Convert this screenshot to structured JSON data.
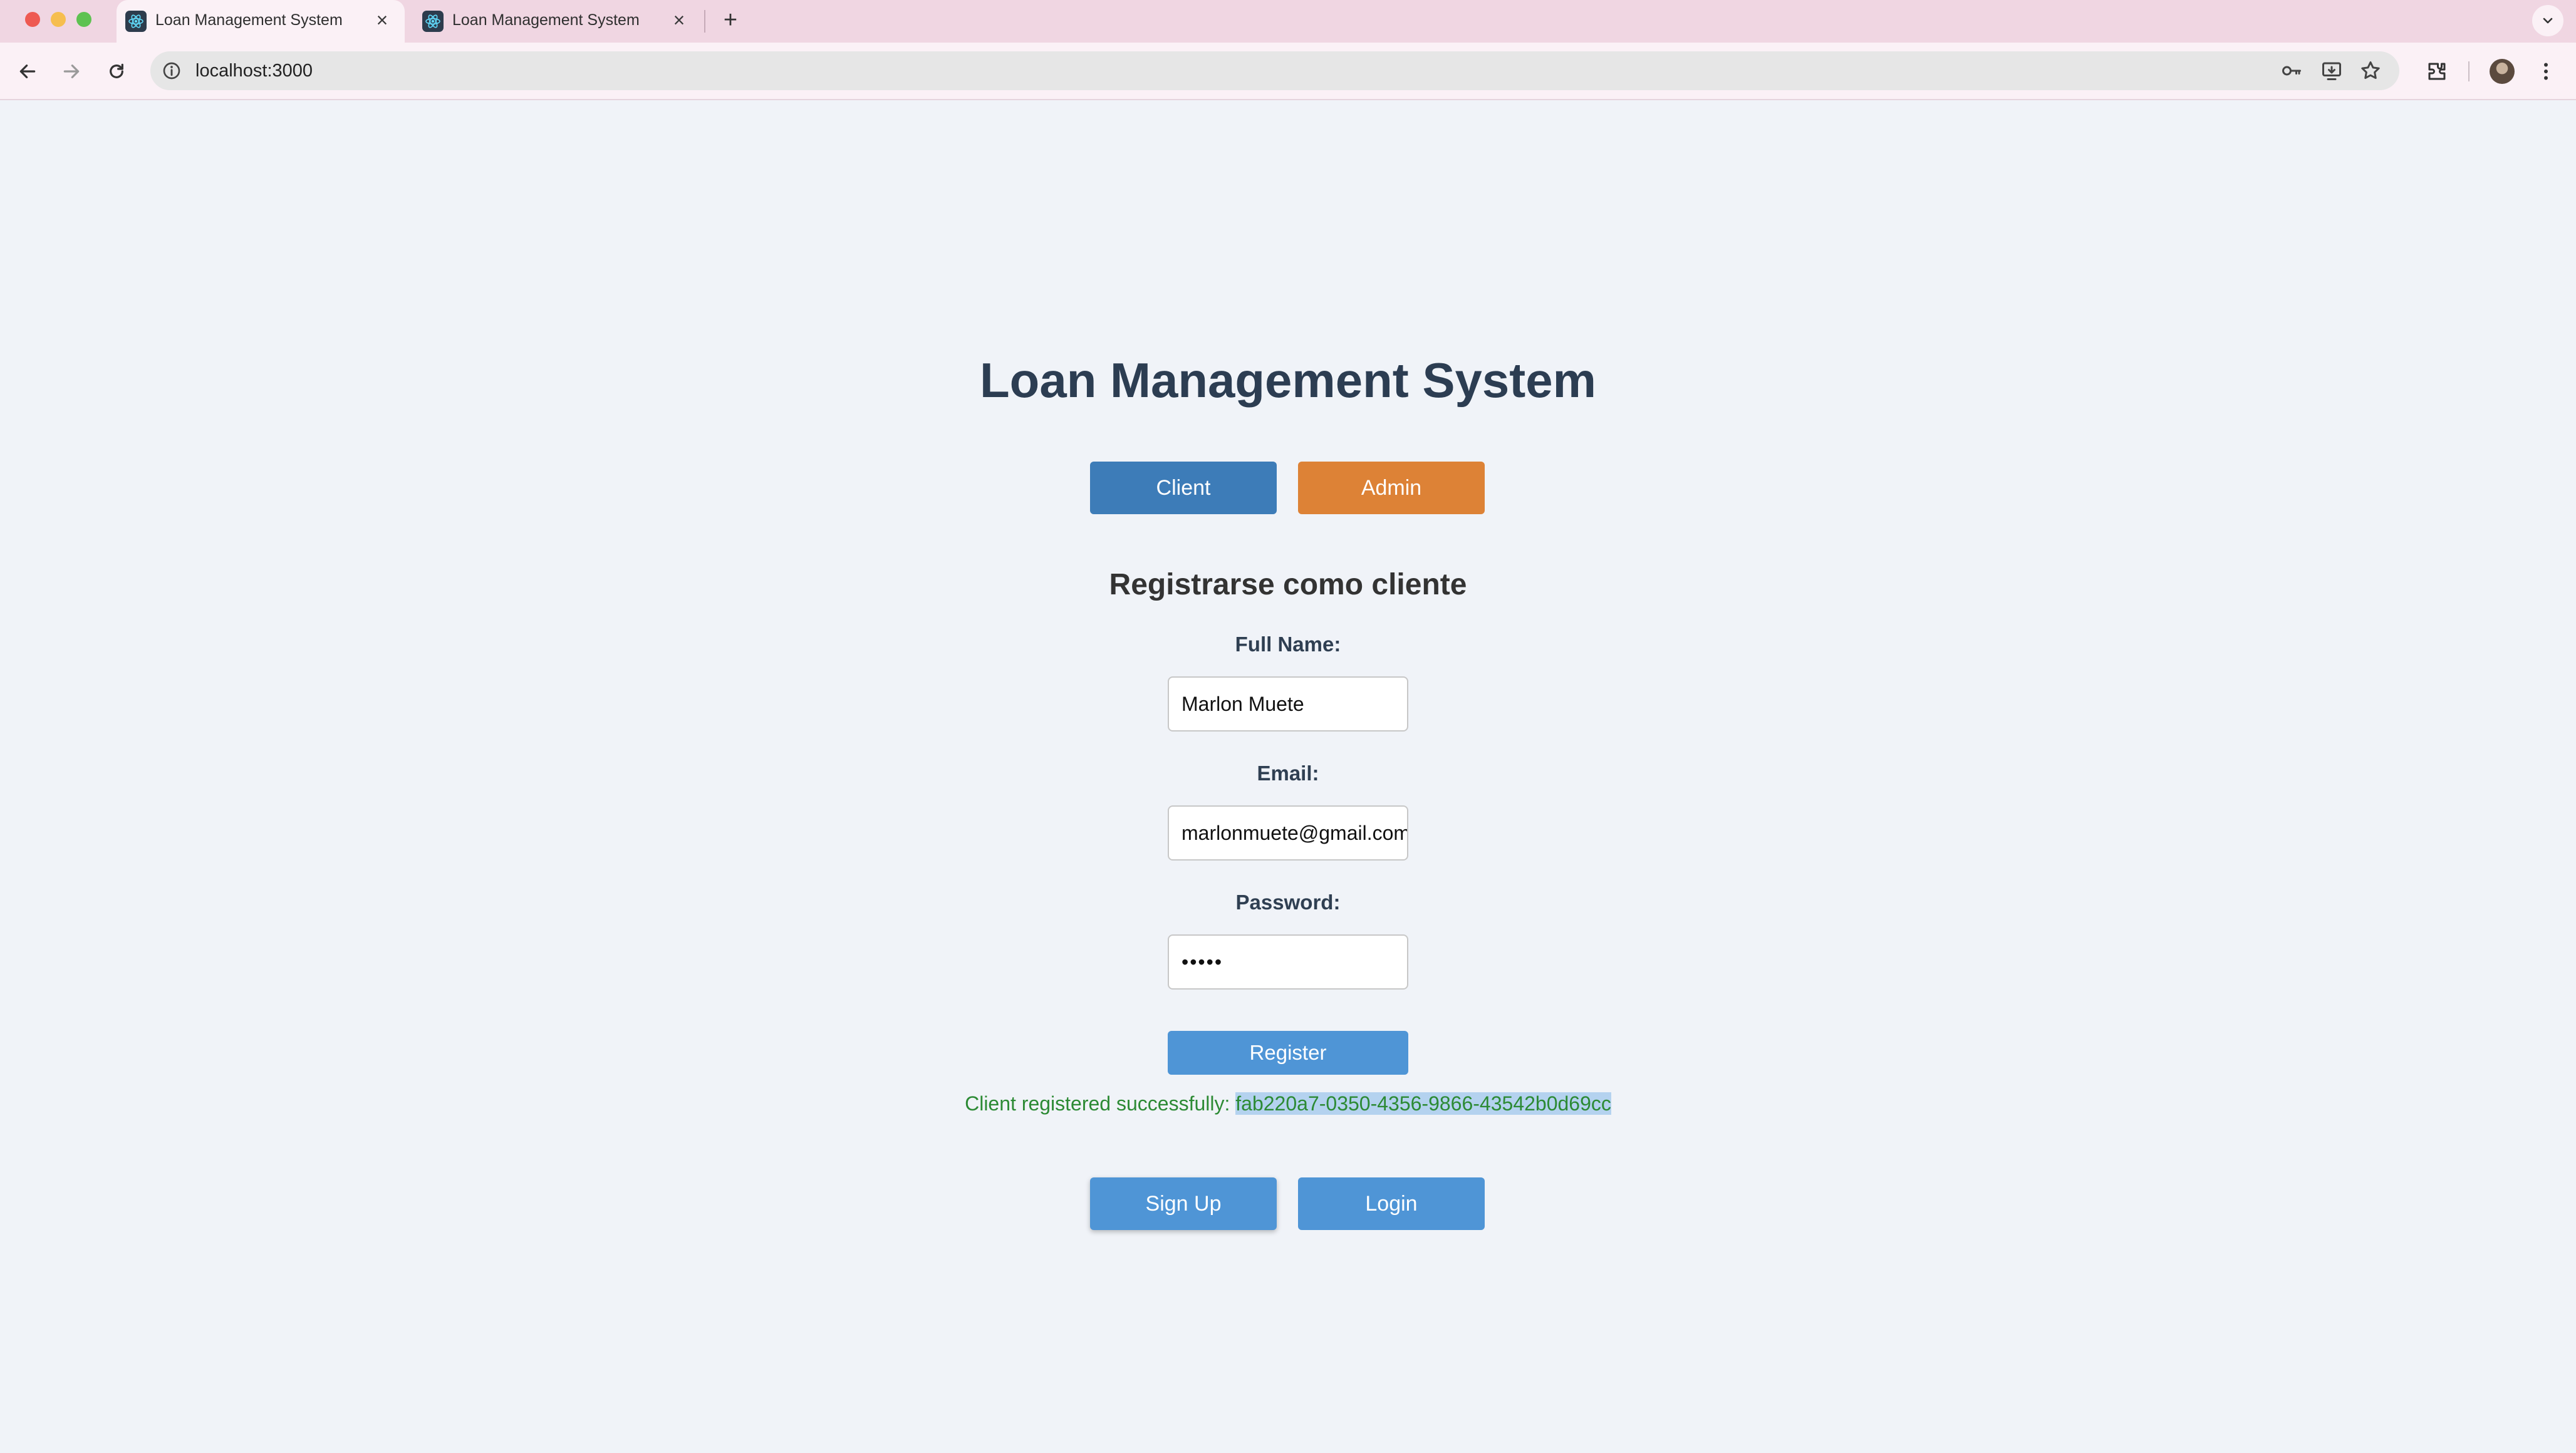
{
  "browser": {
    "tabs": [
      {
        "title": "Loan Management System",
        "active": true
      },
      {
        "title": "Loan Management System",
        "active": false
      }
    ],
    "close_glyph": "×",
    "new_tab_glyph": "+",
    "url": "localhost:3000",
    "icons": [
      "back-icon",
      "forward-icon",
      "reload-icon",
      "site-info-icon",
      "password-key-icon",
      "install-app-icon",
      "bookmark-star-icon",
      "extensions-icon",
      "profile-avatar",
      "menu-icon",
      "tabs-dropdown-icon"
    ]
  },
  "page": {
    "title": "Loan Management System",
    "role_buttons": {
      "client": "Client",
      "admin": "Admin"
    },
    "form": {
      "heading": "Registrarse como cliente",
      "full_name_label": "Full Name:",
      "full_name_value": "Marlon Muete",
      "email_label": "Email:",
      "email_value": "marlonmuete@gmail.com",
      "password_label": "Password:",
      "password_mask": "•••••",
      "register_label": "Register"
    },
    "success": {
      "prefix": "Client registered successfully: ",
      "client_id": "fab220a7-0350-4356-9866-43542b0d69cc"
    },
    "mode_buttons": {
      "signup": "Sign Up",
      "login": "Login"
    }
  },
  "colors": {
    "client_button": "#3d7cb8",
    "admin_button": "#dd8236",
    "primary_button": "#4f95d6",
    "success_text": "#2c8a34",
    "title_text": "#2c3d52",
    "page_background": "#f0f3f8",
    "tab_strip": "#f0d6e2"
  }
}
